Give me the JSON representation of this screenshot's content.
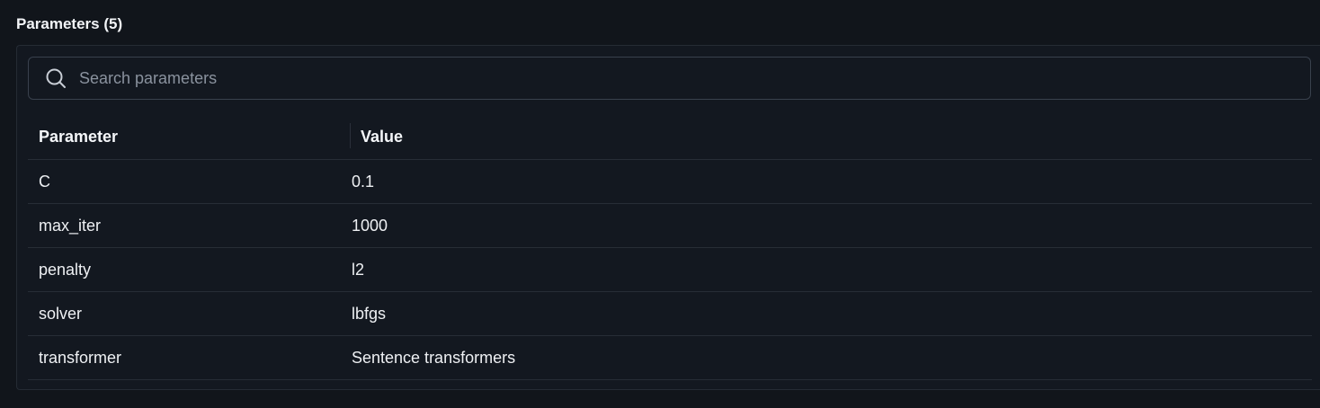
{
  "section": {
    "title": "Parameters (5)"
  },
  "search": {
    "icon": "search-icon",
    "placeholder": "Search parameters",
    "value": ""
  },
  "table": {
    "columns": [
      "Parameter",
      "Value"
    ],
    "rows": [
      {
        "parameter": "C",
        "value": "0.1"
      },
      {
        "parameter": "max_iter",
        "value": "1000"
      },
      {
        "parameter": "penalty",
        "value": "l2"
      },
      {
        "parameter": "solver",
        "value": "lbfgs"
      },
      {
        "parameter": "transformer",
        "value": "Sentence transformers"
      }
    ]
  },
  "colors": {
    "background": "#11151b",
    "panel": "#131820",
    "border": "#252b34",
    "text": "#eef0f3",
    "placeholder": "#8a929e"
  }
}
